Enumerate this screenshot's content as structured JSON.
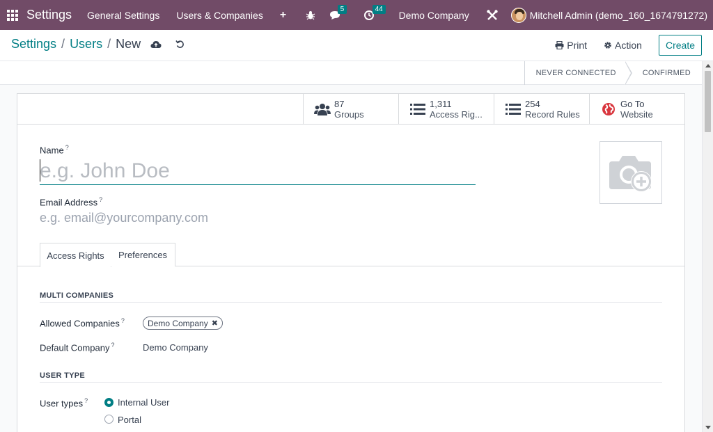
{
  "navbar": {
    "app_title": "Settings",
    "menus": [
      "General Settings",
      "Users & Companies"
    ],
    "add_symbol": "+",
    "messages_count": "5",
    "activities_count": "44",
    "company": "Demo Company",
    "user": "Mitchell Admin (demo_160_1674791272)",
    "accent": "#714B67"
  },
  "control": {
    "breadcrumb": [
      "Settings",
      "Users",
      "New"
    ],
    "print_label": "Print",
    "action_label": "Action",
    "create_label": "Create"
  },
  "statusbar": {
    "stages": [
      "NEVER CONNECTED",
      "CONFIRMED"
    ]
  },
  "smart_buttons": [
    {
      "value": "87",
      "label": "Groups",
      "icon": "users-icon"
    },
    {
      "value": "1,311",
      "label": "Access Rig...",
      "icon": "list-icon"
    },
    {
      "value": "254",
      "label": "Record Rules",
      "icon": "list-icon"
    },
    {
      "value": "Go To",
      "label": "Website",
      "icon": "globe-icon"
    }
  ],
  "form": {
    "name_label": "Name",
    "name_placeholder": "e.g. John Doe",
    "email_label": "Email Address",
    "email_placeholder": "e.g. email@yourcompany.com",
    "help_mark": "?"
  },
  "tabs": [
    "Access Rights",
    "Preferences"
  ],
  "access": {
    "multi_companies_title": "MULTI COMPANIES",
    "allowed_companies_label": "Allowed Companies",
    "allowed_companies_tag": "Demo Company",
    "tag_remove": "✖",
    "default_company_label": "Default Company",
    "default_company_value": "Demo Company",
    "user_type_title": "USER TYPE",
    "user_types_label": "User types",
    "user_type_options": [
      "Internal User",
      "Portal"
    ],
    "selected_user_type": "Internal User"
  },
  "colors": {
    "primary": "#017E84",
    "brand": "#714B67"
  }
}
